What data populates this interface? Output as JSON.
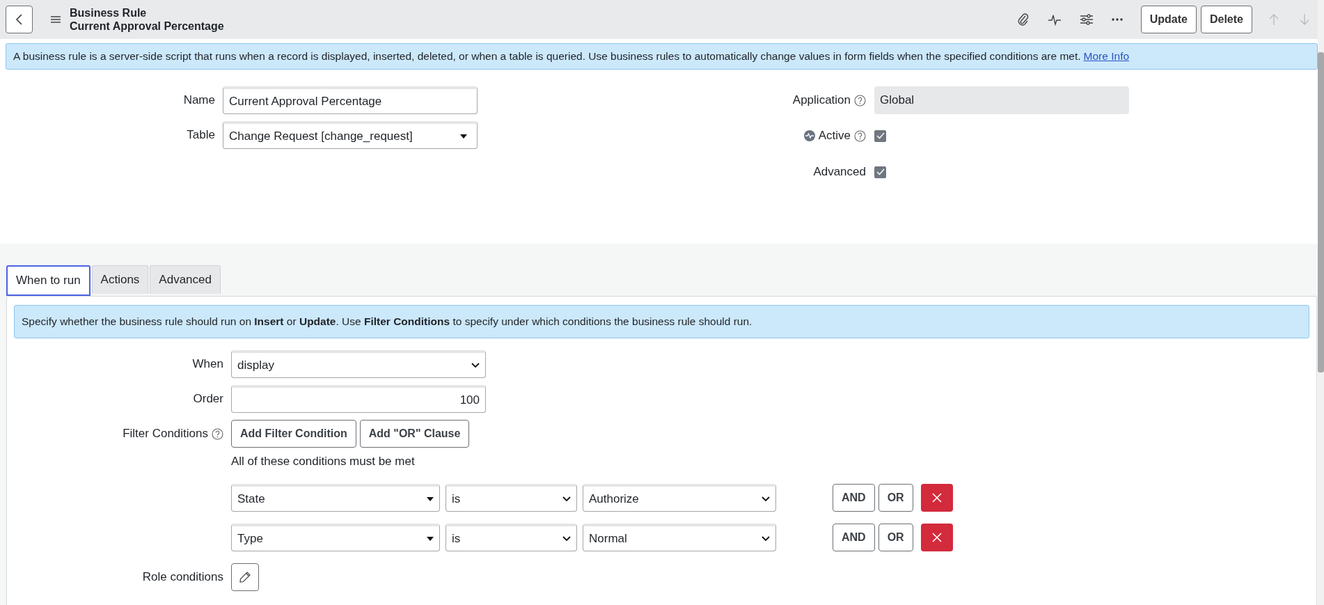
{
  "header": {
    "title": "Business Rule",
    "subtitle": "Current Approval Percentage"
  },
  "toolbar": {
    "buttons": [
      "Update",
      "Delete"
    ]
  },
  "info_banner": {
    "text": "A business rule is a server-side script that runs when a record is displayed, inserted, deleted, or when a table is queried. Use business rules to automatically change values in form fields when the specified conditions are met.",
    "link": "More Info"
  },
  "fields_left": [
    {
      "label": "Name",
      "kind": "text",
      "value": "Current Approval Percentage"
    },
    {
      "label": "Table",
      "kind": "reference",
      "value": "Change Request [change_request]"
    }
  ],
  "fields_right": [
    {
      "label": "Application",
      "kind": "readonly",
      "value": "Global",
      "help": true,
      "activity": false
    },
    {
      "label": "Active",
      "kind": "checkbox",
      "checked": true,
      "help": true,
      "activity": true
    },
    {
      "label": "Advanced",
      "kind": "checkbox",
      "checked": true,
      "help": false,
      "activity": false
    }
  ],
  "tabs": [
    {
      "label": "When to run",
      "selected": true
    },
    {
      "label": "Actions",
      "selected": false
    },
    {
      "label": "Advanced",
      "selected": false
    }
  ],
  "tab_banner": "Specify whether the business rule should run on **Insert** or **Update**. Use **Filter Conditions** to specify under which conditions the business rule should run.",
  "when": {
    "label": "When",
    "value": "display"
  },
  "order": {
    "label": "Order",
    "value": "100"
  },
  "filter": {
    "label": "Filter Conditions",
    "buttons": [
      "Add Filter Condition",
      "Add \"OR\" Clause"
    ],
    "note": "All of these conditions must be met"
  },
  "conditions": [
    {
      "field": "State",
      "operator": "is",
      "value": "Authorize",
      "and": "AND",
      "or": "OR"
    },
    {
      "field": "Type",
      "operator": "is",
      "value": "Normal",
      "and": "AND",
      "or": "OR"
    }
  ],
  "role_conditions": {
    "label": "Role conditions"
  }
}
